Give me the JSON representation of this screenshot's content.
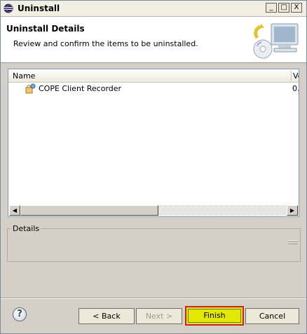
{
  "window": {
    "title": "Uninstall",
    "controls": {
      "minimize": "_",
      "maximize": "□",
      "close": "X"
    }
  },
  "header": {
    "title": "Uninstall Details",
    "description": "Review and confirm the items to be uninstalled.",
    "art_icon": "computer-cd-icon"
  },
  "table": {
    "columns": [
      "Name",
      "Ve"
    ],
    "rows": [
      {
        "name": "COPE Client Recorder",
        "version": "0.",
        "icon": "feature-plugin-icon"
      }
    ]
  },
  "details": {
    "label": "Details"
  },
  "footer": {
    "help": "?",
    "back": "< Back",
    "next": "Next >",
    "finish": "Finish",
    "cancel": "Cancel"
  },
  "colors": {
    "highlight": "#e3e800",
    "highlight_border": "#c9251f"
  }
}
